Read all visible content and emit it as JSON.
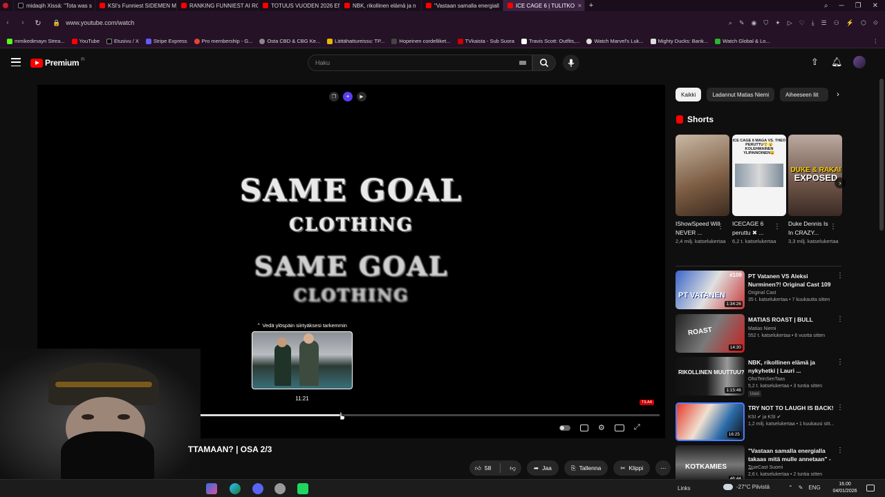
{
  "browser": {
    "tabs": [
      {
        "label": "midaqih Xissä: \"Tota was s",
        "icon": "x-icon",
        "active": false
      },
      {
        "label": "KSI's Funniest SIDEMEN M",
        "icon": "youtube-icon",
        "active": false
      },
      {
        "label": "RANKING FUNNIEST AI RC",
        "icon": "youtube-icon",
        "active": false
      },
      {
        "label": "TOTUUS VUODEN 2026 EN",
        "icon": "youtube-icon",
        "active": false
      },
      {
        "label": "NBK, rikollinen elämä ja n",
        "icon": "youtube-icon",
        "active": false
      },
      {
        "label": "\"Vastaan samalla energiall",
        "icon": "youtube-icon",
        "active": false
      },
      {
        "label": "ICE CAGE 6 | TULITKO",
        "icon": "youtube-icon",
        "active": true
      }
    ],
    "new_tab": "+",
    "url": "www.youtube.com/watch",
    "bookmarks": [
      {
        "label": "mmikedimayn Strea...",
        "color": "#53fc18"
      },
      {
        "label": "YouTube",
        "color": "#ff0000"
      },
      {
        "label": "Etusivu / X",
        "color": "#000000"
      },
      {
        "label": "Stripe Express",
        "color": "#635bff"
      },
      {
        "label": "Pro membership - G...",
        "color": "#ea4335"
      },
      {
        "label": "Osta CBD & CBG Ke...",
        "color": "#888888"
      },
      {
        "label": "Lättähattureissu: TP...",
        "color": "#e6b800"
      },
      {
        "label": "Hopeinen cordelliket...",
        "color": "#444444"
      },
      {
        "label": "TVkaista - Sub Suora",
        "color": "#cc0000"
      },
      {
        "label": "Travis Scott: Outfits,...",
        "color": "#ffffff"
      },
      {
        "label": "Watch Marvel's Luk...",
        "color": "#dddddd"
      },
      {
        "label": "Mighty Ducks: Bank...",
        "color": "#dddddd"
      },
      {
        "label": "Watch Global & Lo...",
        "color": "#2ab52a"
      }
    ]
  },
  "header": {
    "logo_text": "Premium",
    "logo_country": "FI",
    "search_placeholder": "Haku"
  },
  "player": {
    "brand_line1": "SAME GOAL",
    "brand_line2": "CLOTHING",
    "brand_line3": "SAME GOAL",
    "brand_line4": "CLOTHING",
    "preview_hint": "⌃ Vedä ylöspäin siirtyäksesi tarkemmin",
    "preview_time": "11:21",
    "live_badge": "TILAA",
    "progress_fraction": 0.34
  },
  "video": {
    "title": "TTAMAAN? | OSA 2/3",
    "likes": "58",
    "share": "Jaa",
    "save": "Tallenna",
    "clip": "Klippi"
  },
  "sidebar": {
    "chips": [
      "Kaikki",
      "Ladannut Matias Niemi",
      "Aiheeseen liit"
    ],
    "shorts_title": "Shorts",
    "shorts": [
      {
        "title": "IShowSpeed Will NEVER ...",
        "views": "2,4 milj. katselukertaa"
      },
      {
        "title": "ICECAGE 6 peruttu ✖ ...",
        "views": "6,2 t. katselukertaa",
        "thumb_text": "ICE CAGE 6 MAGA VS. THEO PERUTTU😤😮 KOLEHMAINEN YLIPAINOINEN😩"
      },
      {
        "title": "Duke Dennis Is In CRAZY...",
        "views": "3,3 milj. katselukertaa",
        "thumb_line1": "DUKE & RAKAI",
        "thumb_line2": "EXPOSED"
      }
    ],
    "recommendations": [
      {
        "title": "PT Vatanen VS Aleksi Nurminen?! Original Cast 109",
        "channel": "Original Cast",
        "meta": "35 t. katselukertaa • 7 kuukautta sitten",
        "duration": "1:34:26",
        "thumb_text": "PT VATANEN",
        "thumb_num": "#109"
      },
      {
        "title": "MATIAS ROAST | BULL",
        "channel": "Matias Niemi",
        "meta": "552 t. katselukertaa • 6 vuotta sitten",
        "duration": "14:30",
        "thumb_text": "ROAST"
      },
      {
        "title": "NBK, rikollinen elämä ja nykyhetki | Lauri ...",
        "channel": "OhoTeinSenTaas",
        "meta": "5,2 t. katselukertaa • 3 tuntia sitten",
        "duration": "1:15:46",
        "thumb_text": "RIKOLLINEN MUUTTUU?",
        "badge": "Uusi"
      },
      {
        "title": "TRY NOT TO LAUGH IS BACK!",
        "channel": "KSI ✔ ja KSI ✔",
        "meta": "1,2 milj. katselukertaa • 1 kuukausi sitt...",
        "duration": "16:25"
      },
      {
        "title": "\"Vastaan samalla energialla takaas mitä mulle annetaan\" - ...",
        "channel": "TrueCast Suomi",
        "meta": "2,6 t. katselukertaa • 2 tuntia sitten",
        "duration": "46:44",
        "thumb_text": "KOTKAMIES"
      }
    ]
  },
  "taskbar": {
    "links_label": "Links",
    "weather": "-27°C Pilvistä",
    "language": "ENG",
    "time": "16.00",
    "date": "04/01/2026"
  }
}
